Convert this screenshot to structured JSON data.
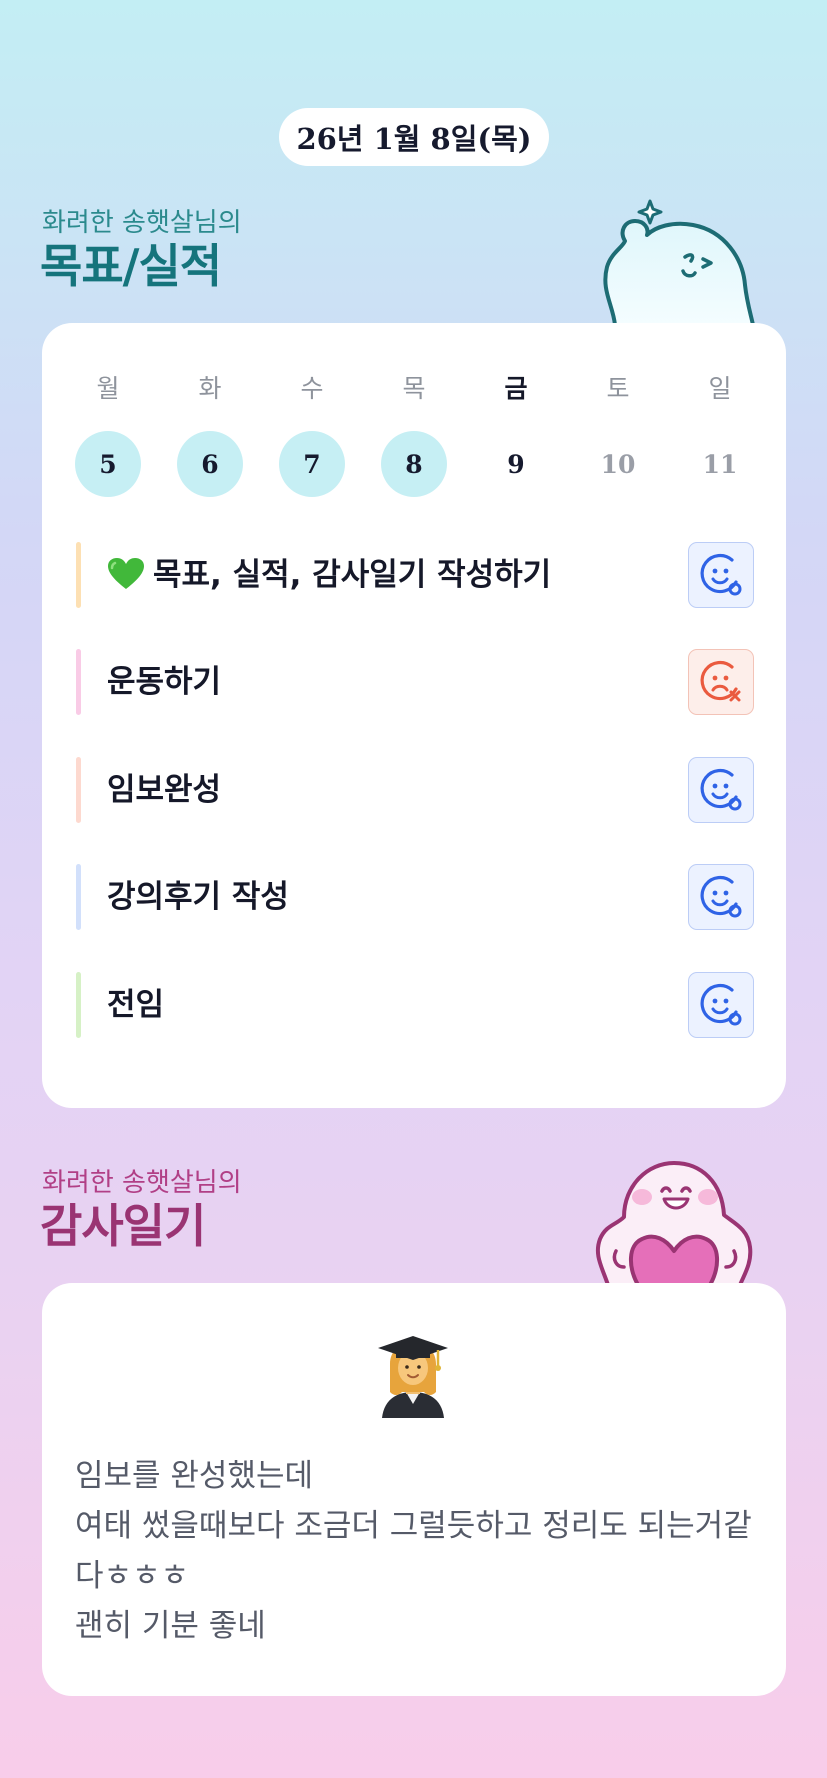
{
  "header": {
    "date": "26년 1월 8일(목)"
  },
  "goals_section": {
    "subtitle": "화려한 송햇살님의",
    "title": "목표/실적"
  },
  "week": [
    {
      "weekday": "월",
      "day": "5",
      "state": "done"
    },
    {
      "weekday": "화",
      "day": "6",
      "state": "done"
    },
    {
      "weekday": "수",
      "day": "7",
      "state": "done"
    },
    {
      "weekday": "목",
      "day": "8",
      "state": "done"
    },
    {
      "weekday": "금",
      "day": "9",
      "state": "today"
    },
    {
      "weekday": "토",
      "day": "10",
      "state": "future"
    },
    {
      "weekday": "일",
      "day": "11",
      "state": "future"
    }
  ],
  "tasks": [
    {
      "label": "목표, 실적, 감사일기 작성하기",
      "icon": "green-heart-emoji",
      "bar_color": "#fde0b3",
      "status": "success"
    },
    {
      "label": "운동하기",
      "bar_color": "#f9cbe6",
      "status": "fail"
    },
    {
      "label": "임보완성",
      "bar_color": "#fdd9cf",
      "status": "success"
    },
    {
      "label": "강의후기 작성",
      "bar_color": "#d2e0fb",
      "status": "success"
    },
    {
      "label": "전임",
      "bar_color": "#d6f1c6",
      "status": "success"
    }
  ],
  "status_colors": {
    "success": "#2f63e6",
    "fail": "#ea5a3f"
  },
  "diary_section": {
    "subtitle": "화려한 송햇살님의",
    "title": "감사일기",
    "emoji": "student-emoji",
    "lines": [
      "임보를 완성했는데",
      "여태 썼을때보다 조금더 그럴듯하고 정리도 되는거같",
      "다ㅎㅎㅎ",
      "괜히 기분 좋네"
    ]
  }
}
